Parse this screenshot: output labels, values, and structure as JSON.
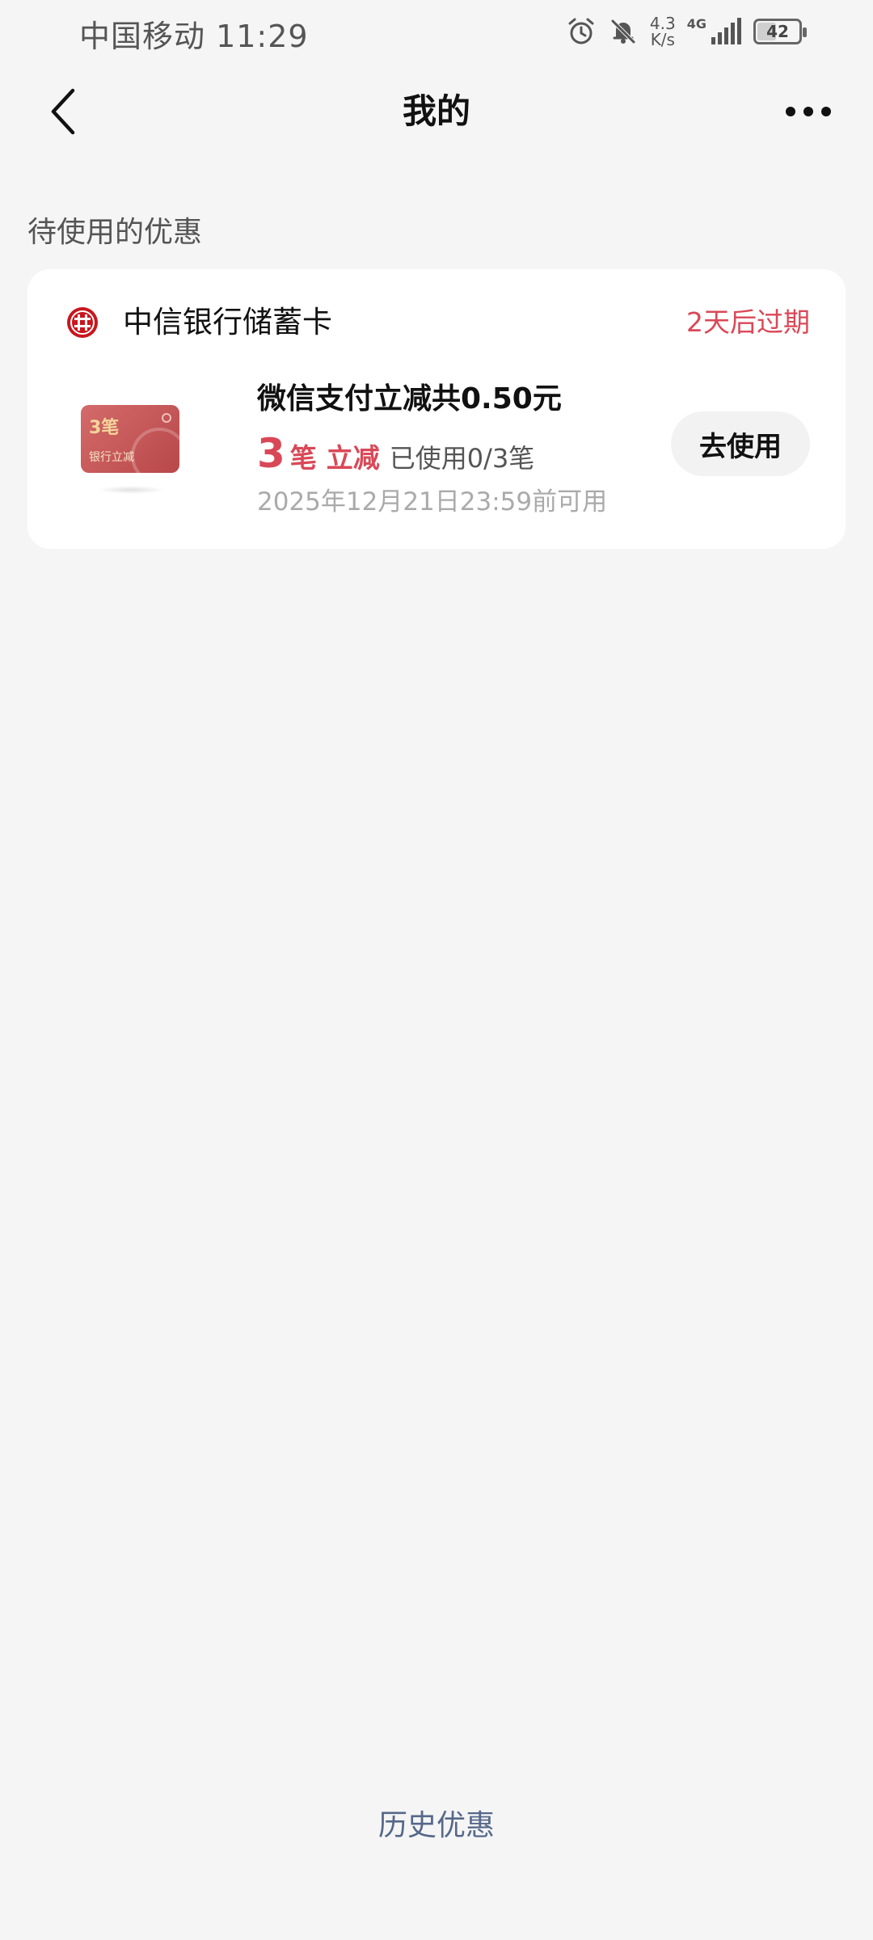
{
  "status_bar": {
    "carrier_time": "中国移动 11:29",
    "net_speed_value": "4.3",
    "net_speed_unit": "K/s",
    "network": "4G",
    "battery": "42",
    "battery_level": 0.42
  },
  "nav": {
    "title": "我的",
    "back_icon": "chevron-left-icon",
    "more_icon": "more-dots-icon"
  },
  "section": {
    "title": "待使用的优惠"
  },
  "coupon": {
    "bank_name": "中信银行储蓄卡",
    "expire": "2天后过期",
    "title": "微信支付立减共0.50元",
    "count": "3",
    "count_unit": "笔",
    "count_type": "立减",
    "used": "已使用0/3笔",
    "valid_until": "2025年12月21日23:59前可用",
    "button": "去使用",
    "image": {
      "num": "3笔",
      "label": "银行立减"
    }
  },
  "footer": {
    "history": "历史优惠"
  },
  "colors": {
    "accent_red": "#d94857",
    "link_blue": "#56688a",
    "background": "#f5f5f5"
  }
}
